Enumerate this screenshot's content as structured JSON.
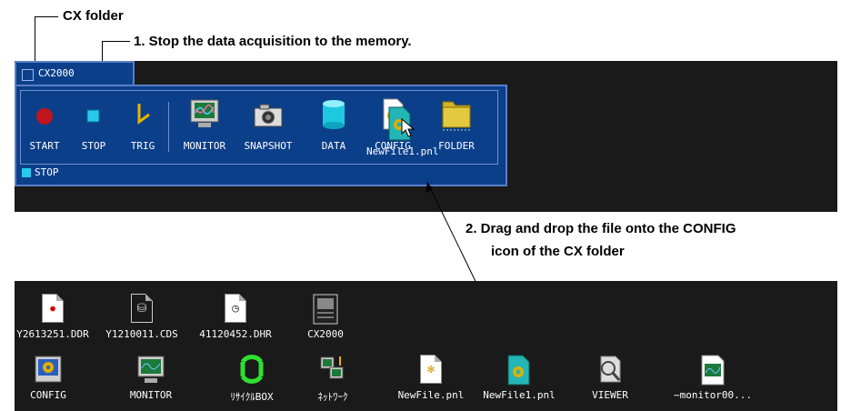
{
  "annotations": {
    "cx_folder": "CX folder",
    "step1": "1. Stop the data acquisition to the memory.",
    "step2_line1": "2. Drag and drop the file onto the CONFIG",
    "step2_line2": "icon of the CX folder"
  },
  "cx_window": {
    "tab_label": "CX2000",
    "toolbar": [
      {
        "label": "START",
        "icon": "record-dot-icon"
      },
      {
        "label": "STOP",
        "icon": "stop-square-icon"
      },
      {
        "label": "TRIG",
        "icon": "trigger-icon"
      },
      {
        "label": "MONITOR",
        "icon": "monitor-icon"
      },
      {
        "label": "SNAPSHOT",
        "icon": "camera-icon"
      },
      {
        "label": "DATA",
        "icon": "database-icon"
      },
      {
        "label": "CONFIG",
        "icon": "config-file-icon"
      },
      {
        "label": "FOLDER",
        "icon": "folder-icon"
      }
    ],
    "dragged_file_label": "NewFile1.pnl",
    "status_text": "STOP"
  },
  "desktop": {
    "row1": [
      {
        "label": "Y2613251.DDR",
        "icon": "ddr-file-icon"
      },
      {
        "label": "Y1210011.CDS",
        "icon": "cds-file-icon"
      },
      {
        "label": "41120452.DHR",
        "icon": "dhr-file-icon"
      },
      {
        "label": "CX2000",
        "icon": "cx2000-device-icon"
      }
    ],
    "row2": [
      {
        "label": "CONFIG",
        "icon": "config-app-icon"
      },
      {
        "label": "MONITOR",
        "icon": "monitor-app-icon"
      },
      {
        "label": "ﾘｻｲｸﾙBOX",
        "icon": "recycle-box-icon"
      },
      {
        "label": "ﾈｯﾄﾜｰｸ",
        "icon": "network-icon"
      },
      {
        "label": "NewFile.pnl",
        "icon": "pnl-file-icon"
      },
      {
        "label": "NewFile1.pnl",
        "icon": "pnl-file-selected-icon"
      },
      {
        "label": "VIEWER",
        "icon": "viewer-icon"
      },
      {
        "label": "~monitor00...",
        "icon": "monitor-file-icon"
      }
    ]
  },
  "colors": {
    "window_bg": "#1a1a1a",
    "panel_blue": "#0c3f8a",
    "panel_border": "#5a7fc8",
    "accent_cyan": "#27c9ee",
    "start_red": "#c0141e",
    "trig_yellow": "#e8b400"
  }
}
